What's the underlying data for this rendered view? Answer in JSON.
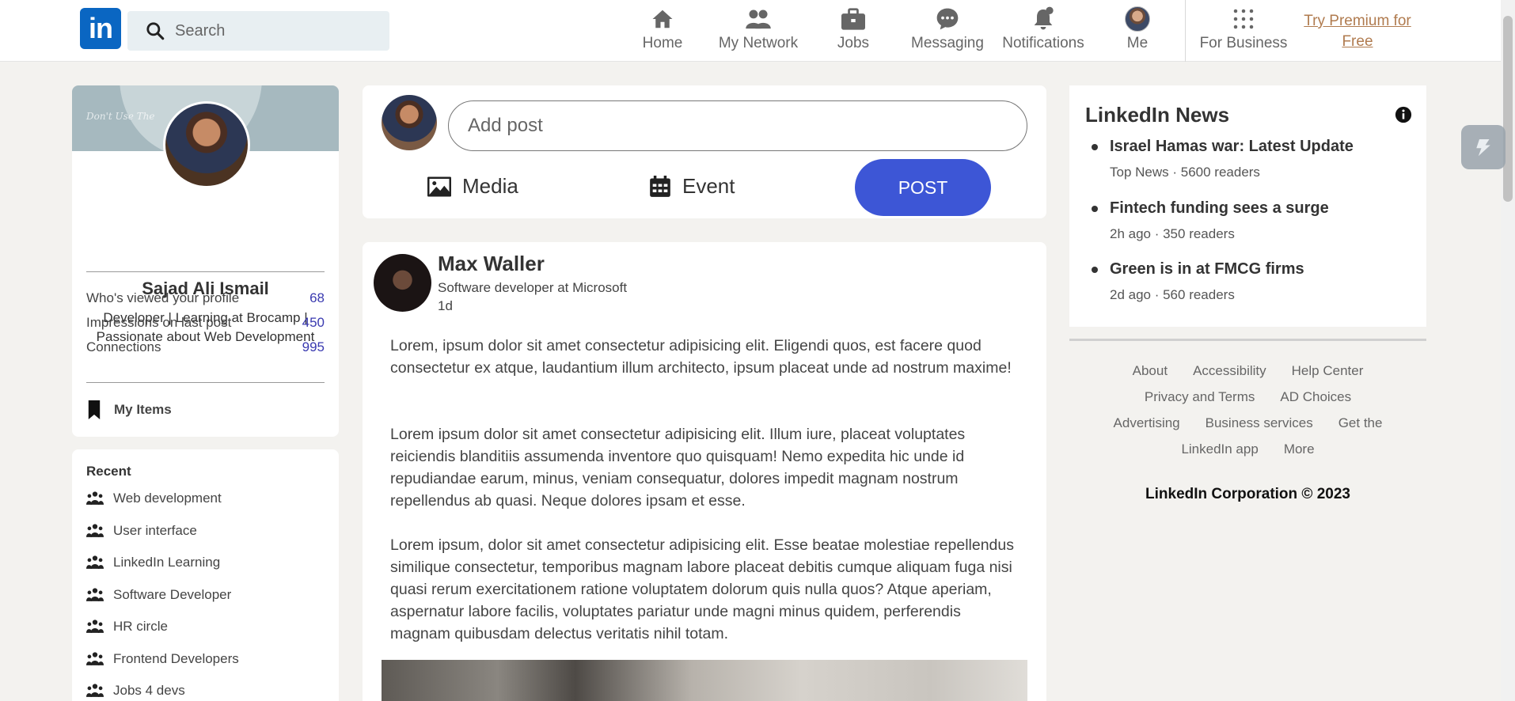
{
  "nav": {
    "logo": "in",
    "search_placeholder": "Search",
    "items": [
      {
        "label": "Home",
        "icon": "home-icon"
      },
      {
        "label": "My Network",
        "icon": "network-icon"
      },
      {
        "label": "Jobs",
        "icon": "briefcase-icon"
      },
      {
        "label": "Messaging",
        "icon": "messaging-icon"
      },
      {
        "label": "Notifications",
        "icon": "bell-icon"
      },
      {
        "label": "Me",
        "icon": "avatar"
      },
      {
        "label": "For Business",
        "icon": "grid-icon"
      }
    ],
    "premium_line1": "Try Premium for",
    "premium_line2": "Free",
    "premium_color": "#b07b4f"
  },
  "profile": {
    "banner_text": "Don't Use The",
    "name": "Sajad Ali Ismail",
    "headline": "Developer | Learning at Brocamp | Passionate about Web Development",
    "stats": [
      {
        "label": "Who's viewed your profile",
        "value": "68"
      },
      {
        "label": "Impressions on last post",
        "value": "450"
      },
      {
        "label": "Connections",
        "value": "995"
      }
    ],
    "my_items": "My Items"
  },
  "recent": {
    "title": "Recent",
    "items": [
      "Web development",
      "User interface",
      "LinkedIn Learning",
      "Software Developer",
      "HR circle",
      "Frontend Developers",
      "Jobs 4 devs"
    ]
  },
  "composer": {
    "placeholder": "Add post",
    "media": "Media",
    "event": "Event",
    "post": "POST",
    "accent": "#3d56d6"
  },
  "post": {
    "author": "Max Waller",
    "title": "Software developer at Microsoft",
    "time": "1d",
    "paragraphs": [
      "Lorem, ipsum dolor sit amet consectetur adipisicing elit. Eligendi quos, est facere quod consectetur ex atque, laudantium illum architecto, ipsum placeat unde ad nostrum maxime!",
      "Lorem ipsum dolor sit amet consectetur adipisicing elit. Illum iure, placeat voluptates reiciendis blanditiis assumenda inventore quo quisquam! Nemo expedita hic unde id repudiandae earum, minus, veniam consequatur, dolores impedit magnam nostrum repellendus ab quasi. Neque dolores ipsam et esse.",
      "Lorem ipsum, dolor sit amet consectetur adipisicing elit. Esse beatae molestiae repellendus similique consectetur, temporibus magnam labore placeat debitis cumque aliquam fuga nisi quasi rerum exercitationem ratione voluptatem dolorum quis nulla quos? Atque aperiam, aspernatur labore facilis, voluptates pariatur unde magni minus quidem, perferendis magnam quibusdam delectus veritatis nihil totam."
    ]
  },
  "news": {
    "title": "LinkedIn News",
    "items": [
      {
        "headline": "Israel Hamas war: Latest Update",
        "meta": "Top News · 5600 readers"
      },
      {
        "headline": "Fintech funding sees a surge",
        "meta": "2h ago · 350 readers"
      },
      {
        "headline": "Green is in at FMCG firms",
        "meta": "2d ago · 560 readers"
      }
    ]
  },
  "footer": {
    "row1": [
      "About",
      "Accessibility",
      "Help Center"
    ],
    "row2": [
      "Privacy and Terms",
      "AD Choices"
    ],
    "row3": [
      "Advertising",
      "Business services",
      "Get the"
    ],
    "row4": [
      "LinkedIn app",
      "More"
    ],
    "copyright": "LinkedIn Corporation © 2023"
  }
}
